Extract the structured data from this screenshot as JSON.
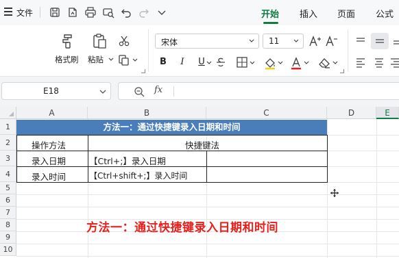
{
  "menu": {
    "file_label": "文件",
    "tabs": [
      "开始",
      "插入",
      "页面",
      "公式"
    ],
    "active_tab": "开始"
  },
  "quick_access_icons": [
    "save-icon",
    "template-icon",
    "print-icon",
    "print-preview-icon",
    "undo-icon",
    "redo-icon",
    "chevron-down-icon"
  ],
  "ribbon": {
    "format_painter_label": "格式刷",
    "paste_label": "粘贴",
    "font_name": "宋体",
    "font_size": "11"
  },
  "formula_bar": {
    "cell_ref": "E18",
    "fx_label": "fx",
    "formula": ""
  },
  "grid": {
    "columns": [
      "A",
      "B",
      "C",
      "D",
      "E"
    ],
    "rows": [
      "1",
      "2",
      "3",
      "4",
      "5",
      "6",
      "7",
      "8",
      "9",
      "10"
    ],
    "title": "方法一：通过快捷键录入日期和时间",
    "header_a": "操作方法",
    "header_bc": "快捷键法",
    "row3_a": "录入日期",
    "row3_b": "【Ctrl+;】录入日期",
    "row4_a": "录入时间",
    "row4_b": "【Ctrl+shift+;】录入时间",
    "caption": "方法一：通过快捷键录入日期和时间"
  },
  "colors": {
    "accent": "#107c41",
    "title_fill": "#4a7ebb",
    "caption_red": "#e8201b"
  }
}
